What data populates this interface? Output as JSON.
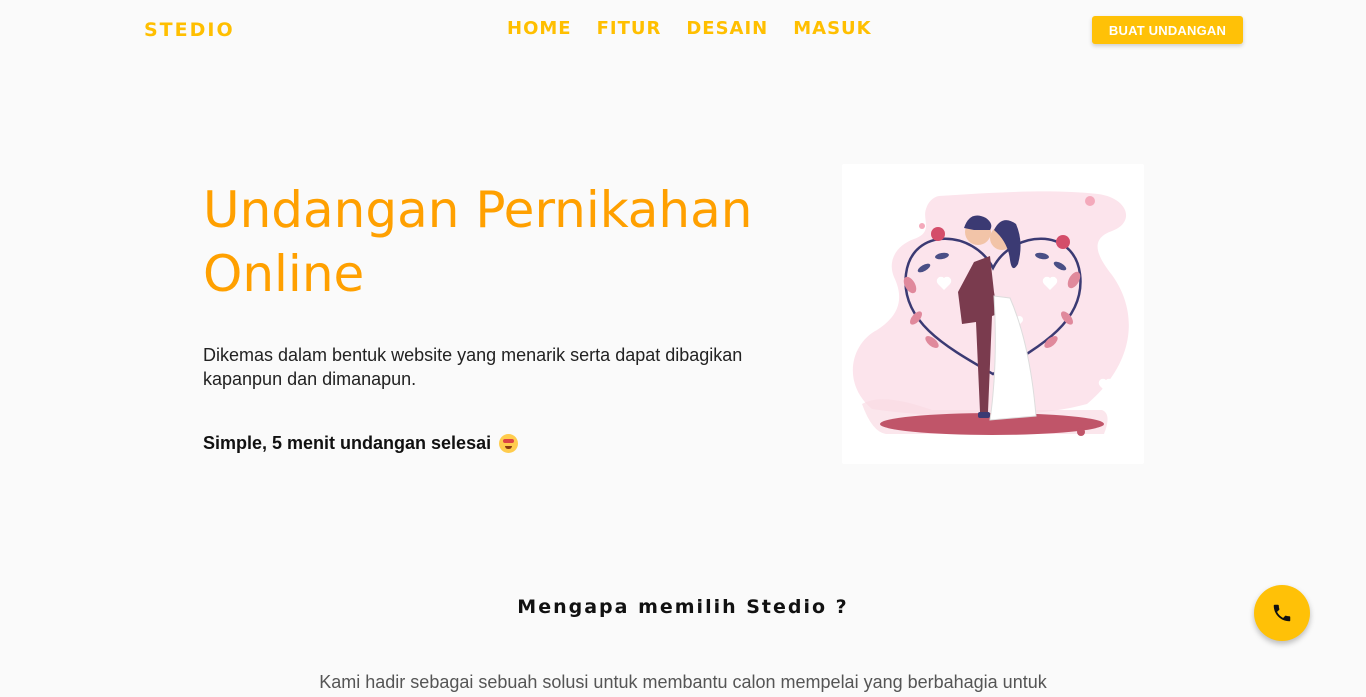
{
  "header": {
    "brand": "STEDIO",
    "nav": [
      "HOME",
      "FITUR",
      "DESAIN",
      "MASUK"
    ],
    "cta_label": "BUAT UNDANGAN"
  },
  "hero": {
    "title": "Undangan Pernikahan Online",
    "description": "Dikemas dalam bentuk website yang menarik serta dapat dibagikan kapanpun dan dimanapun.",
    "tagline": "Simple, 5 menit undangan selesai",
    "emoji_icon": "grinning-face-emoji",
    "illustration": "couple-kissing-under-floral-heart"
  },
  "why": {
    "title": "Mengapa memilih Stedio ?",
    "text": "Kami hadir sebagai sebuah solusi untuk membantu calon mempelai yang berbahagia untuk"
  },
  "floating_action": {
    "icon": "phone-icon",
    "color": "#ffc107"
  },
  "colors": {
    "accent": "#ffbf00",
    "title_orange": "#ffa000",
    "background": "#fafafa"
  }
}
